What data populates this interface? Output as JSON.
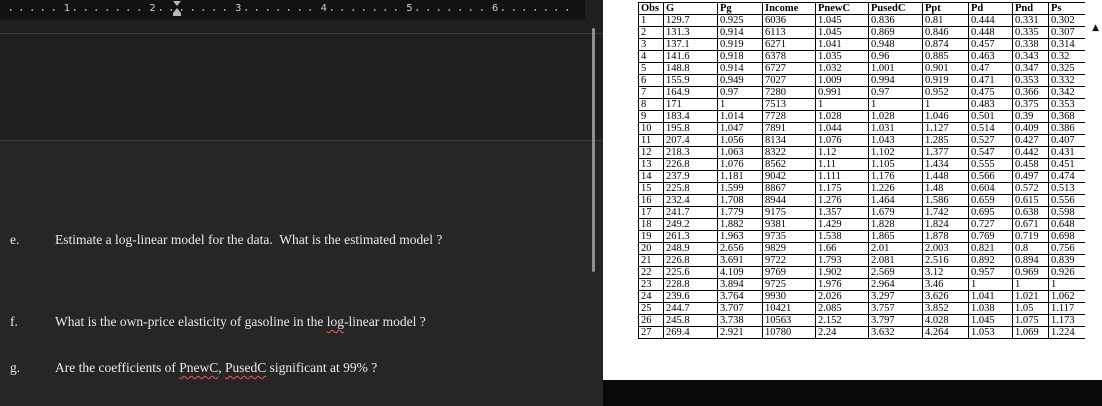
{
  "ruler": {
    "numbers": [
      "1",
      "2",
      "3",
      "4",
      "5",
      "6"
    ]
  },
  "document": {
    "items": [
      {
        "label": "e.",
        "parts": [
          {
            "text": "Estimate a log-linear model for the data.  What is the estimated model ?"
          }
        ]
      },
      {
        "label": "f.",
        "parts": [
          {
            "text": "What is the own-price elasticity of gasoline in the "
          },
          {
            "text": "log",
            "misspelled": true
          },
          {
            "text": "-linear model ?"
          }
        ]
      },
      {
        "label": "g.",
        "parts": [
          {
            "text": "Are the coefficients of "
          },
          {
            "text": "PnewC",
            "misspelled": true
          },
          {
            "text": ", "
          },
          {
            "text": "PusedC",
            "misspelled": true
          },
          {
            "text": " significant at 99% ?"
          }
        ]
      }
    ],
    "spellcheck_color": "#ff5252"
  },
  "scrollbar": {
    "up_arrow": "▲"
  },
  "table": {
    "headers": [
      "Obs",
      "G",
      "Pg",
      "Income",
      "PnewC",
      "PusedC",
      "Ppt",
      "Pd",
      "Pnd",
      "Ps"
    ],
    "rows": [
      [
        "1",
        "129.7",
        "0.925",
        "6036",
        "1.045",
        "0.836",
        "0.81",
        "0.444",
        "0.331",
        "0.302"
      ],
      [
        "2",
        "131.3",
        "0.914",
        "6113",
        "1.045",
        "0.869",
        "0.846",
        "0.448",
        "0.335",
        "0.307"
      ],
      [
        "3",
        "137.1",
        "0.919",
        "6271",
        "1.041",
        "0.948",
        "0.874",
        "0.457",
        "0.338",
        "0.314"
      ],
      [
        "4",
        "141.6",
        "0.918",
        "6378",
        "1.035",
        "0.96",
        "0.885",
        "0.463",
        "0.343",
        "0.32"
      ],
      [
        "5",
        "148.8",
        "0.914",
        "6727",
        "1.032",
        "1.001",
        "0.901",
        "0.47",
        "0.347",
        "0.325"
      ],
      [
        "6",
        "155.9",
        "0.949",
        "7027",
        "1.009",
        "0.994",
        "0.919",
        "0.471",
        "0.353",
        "0.332"
      ],
      [
        "7",
        "164.9",
        "0.97",
        "7280",
        "0.991",
        "0.97",
        "0.952",
        "0.475",
        "0.366",
        "0.342"
      ],
      [
        "8",
        "171",
        "1",
        "7513",
        "1",
        "1",
        "1",
        "0.483",
        "0.375",
        "0.353"
      ],
      [
        "9",
        "183.4",
        "1.014",
        "7728",
        "1.028",
        "1.028",
        "1.046",
        "0.501",
        "0.39",
        "0.368"
      ],
      [
        "10",
        "195.8",
        "1.047",
        "7891",
        "1.044",
        "1.031",
        "1.127",
        "0.514",
        "0.409",
        "0.386"
      ],
      [
        "11",
        "207.4",
        "1.056",
        "8134",
        "1.076",
        "1.043",
        "1.285",
        "0.527",
        "0.427",
        "0.407"
      ],
      [
        "12",
        "218.3",
        "1.063",
        "8322",
        "1.12",
        "1.102",
        "1.377",
        "0.547",
        "0.442",
        "0.431"
      ],
      [
        "13",
        "226.8",
        "1.076",
        "8562",
        "1.11",
        "1.105",
        "1.434",
        "0.555",
        "0.458",
        "0.451"
      ],
      [
        "14",
        "237.9",
        "1.181",
        "9042",
        "1.111",
        "1.176",
        "1.448",
        "0.566",
        "0.497",
        "0.474"
      ],
      [
        "15",
        "225.8",
        "1.599",
        "8867",
        "1.175",
        "1.226",
        "1.48",
        "0.604",
        "0.572",
        "0.513"
      ],
      [
        "16",
        "232.4",
        "1.708",
        "8944",
        "1.276",
        "1.464",
        "1.586",
        "0.659",
        "0.615",
        "0.556"
      ],
      [
        "17",
        "241.7",
        "1.779",
        "9175",
        "1.357",
        "1.679",
        "1.742",
        "0.695",
        "0.638",
        "0.598"
      ],
      [
        "18",
        "249.2",
        "1.882",
        "9381",
        "1.429",
        "1.828",
        "1.824",
        "0.727",
        "0.671",
        "0.648"
      ],
      [
        "19",
        "261.3",
        "1.963",
        "9735",
        "1.538",
        "1.865",
        "1.878",
        "0.769",
        "0.719",
        "0.698"
      ],
      [
        "20",
        "248.9",
        "2.656",
        "9829",
        "1.66",
        "2.01",
        "2.003",
        "0.821",
        "0.8",
        "0.756"
      ],
      [
        "21",
        "226.8",
        "3.691",
        "9722",
        "1.793",
        "2.081",
        "2.516",
        "0.892",
        "0.894",
        "0.839"
      ],
      [
        "22",
        "225.6",
        "4.109",
        "9769",
        "1.902",
        "2.569",
        "3.12",
        "0.957",
        "0.969",
        "0.926"
      ],
      [
        "23",
        "228.8",
        "3.894",
        "9725",
        "1.976",
        "2.964",
        "3.46",
        "1",
        "1",
        "1"
      ],
      [
        "24",
        "239.6",
        "3.764",
        "9930",
        "2.026",
        "3.297",
        "3.626",
        "1.041",
        "1.021",
        "1.062"
      ],
      [
        "25",
        "244.7",
        "3.707",
        "10421",
        "2.085",
        "3.757",
        "3.852",
        "1.038",
        "1.05",
        "1.117"
      ],
      [
        "26",
        "245.8",
        "3.738",
        "10563",
        "2.152",
        "3.797",
        "4.028",
        "1.045",
        "1.075",
        "1.173"
      ],
      [
        "27",
        "269.4",
        "2.921",
        "10780",
        "2.24",
        "3.632",
        "4.264",
        "1.053",
        "1.069",
        "1.224"
      ]
    ]
  }
}
